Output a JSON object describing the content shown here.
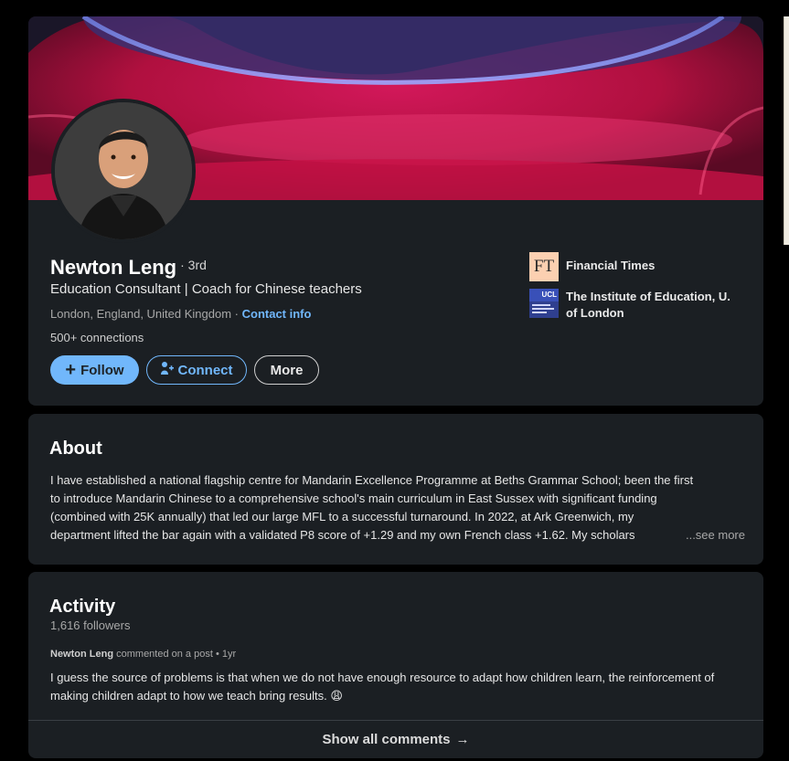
{
  "profile": {
    "name": "Newton Leng",
    "degree": "· 3rd",
    "headline": "Education Consultant | Coach for Chinese teachers",
    "location": "London, England, United Kingdom",
    "location_sep": " · ",
    "contact_label": "Contact info",
    "connections": "500+ connections",
    "buttons": {
      "follow": "Follow",
      "connect": "Connect",
      "more": "More"
    },
    "orgs": [
      {
        "logo_text": "FT",
        "name": "Financial Times",
        "logo_color": "#fcd0b1"
      },
      {
        "logo_text": "UCL",
        "name": "The Institute of Education, U. of London",
        "logo_color": "#2f3f8f"
      }
    ]
  },
  "about": {
    "title": "About",
    "lines": [
      "I have established a national flagship centre for Mandarin Excellence Programme at Beths Grammar School; been the first",
      "to introduce Mandarin Chinese to a comprehensive school's main curriculum in East Sussex with significant funding",
      "(combined with 25K annually) that led our large MFL to a successful turnaround. In 2022, at Ark Greenwich, my",
      "department lifted the bar again with a validated P8 score of +1.29 and my own French class +1.62. My scholars"
    ],
    "see_more": "...see more"
  },
  "activity": {
    "title": "Activity",
    "followers": "1,616 followers",
    "post": {
      "author": "Newton Leng",
      "action": " commented on a post • 1yr",
      "text": "I guess the source of problems is that when we do not have enough resource to adapt how children learn, the reinforcement of making children adapt to how we teach bring results. 😩"
    },
    "show_all": "Show all comments"
  },
  "colors": {
    "accent": "#71b7fb",
    "card": "#1b1f23",
    "background": "#000000"
  }
}
